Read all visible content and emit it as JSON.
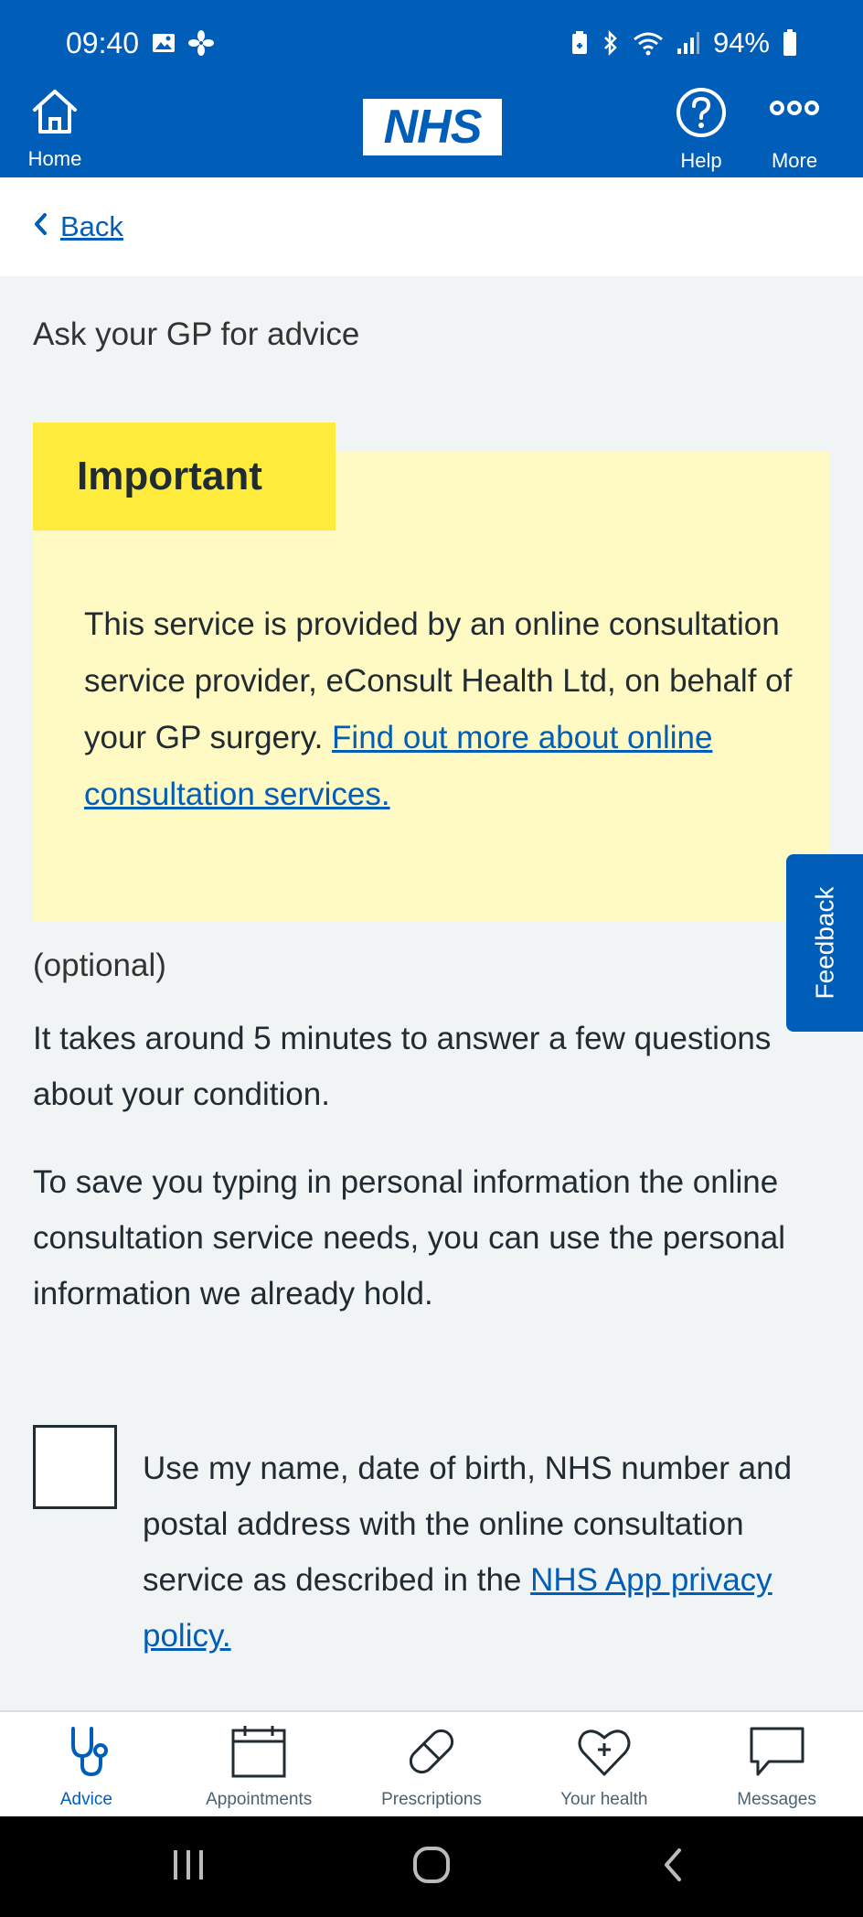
{
  "status_bar": {
    "time": "09:40",
    "battery": "94%",
    "icons": [
      "image-icon",
      "fan-icon",
      "battery-saver-icon",
      "bluetooth-icon",
      "wifi-icon",
      "signal-icon",
      "battery-icon"
    ]
  },
  "header": {
    "home_label": "Home",
    "logo_text": "NHS",
    "help_label": "Help",
    "more_label": "More"
  },
  "back": {
    "label": "Back"
  },
  "page": {
    "heading": "Ask your GP for advice",
    "callout": {
      "label": "Important",
      "body": "This service is provided by an online consultation service provider, eConsult Health Ltd, on behalf of your GP surgery.",
      "link": "Find out more about online consultation services."
    },
    "optional": "(optional)",
    "takes_time": "It takes around 5 minutes to answer a few questions about your condition.",
    "save_typing": "To save you typing in personal information the online consultation service needs, you can use the personal information we already hold.",
    "checkbox_text": "Use my name, date of birth, NHS number and postal address with the online consultation service as described in the",
    "checkbox_link": "NHS App privacy policy.",
    "checkbox_checked": false
  },
  "feedback": {
    "label": "Feedback"
  },
  "bottom_nav": {
    "items": [
      {
        "label": "Advice",
        "icon": "stethoscope-icon",
        "active": true
      },
      {
        "label": "Appointments",
        "icon": "calendar-icon",
        "active": false
      },
      {
        "label": "Prescriptions",
        "icon": "pill-icon",
        "active": false
      },
      {
        "label": "Your health",
        "icon": "heart-plus-icon",
        "active": false
      },
      {
        "label": "Messages",
        "icon": "message-icon",
        "active": false
      }
    ]
  },
  "colors": {
    "nhs_blue": "#005eb8",
    "callout_bg": "#fff9c4",
    "callout_label_bg": "#ffeb3b",
    "page_bg": "#f0f4f5"
  }
}
